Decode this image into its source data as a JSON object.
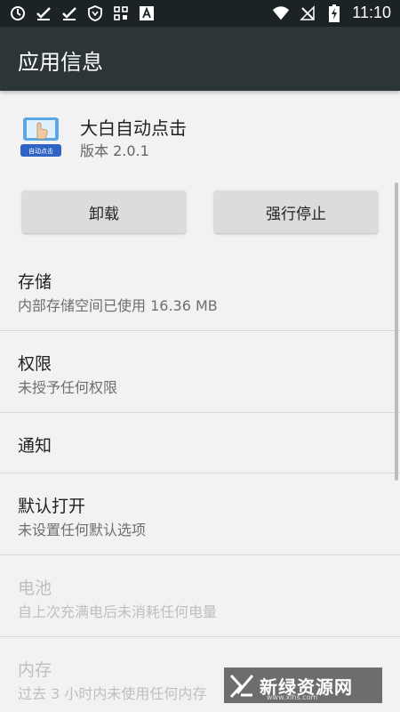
{
  "status_bar": {
    "time": "11:10",
    "left_icons": [
      "sync-icon",
      "check-icon",
      "check-icon",
      "shield-icon",
      "grid-icon",
      "a-box-icon"
    ],
    "right_icons": [
      "wifi-icon",
      "no-signal-icon",
      "battery-charging-icon"
    ]
  },
  "app_bar": {
    "title": "应用信息"
  },
  "app": {
    "name": "大白自动点击",
    "version": "版本 2.0.1",
    "icon_caption": "自动点击"
  },
  "buttons": {
    "uninstall": "卸载",
    "force_stop": "强行停止"
  },
  "sections": [
    {
      "title": "存储",
      "subtitle": "内部存储空间已使用 16.36 MB",
      "enabled": true
    },
    {
      "title": "权限",
      "subtitle": "未授予任何权限",
      "enabled": true
    },
    {
      "title": "通知",
      "subtitle": "",
      "enabled": true
    },
    {
      "title": "默认打开",
      "subtitle": "未设置任何默认选项",
      "enabled": true
    },
    {
      "title": "电池",
      "subtitle": "自上次充满电后未消耗任何电量",
      "enabled": false
    },
    {
      "title": "内存",
      "subtitle": "过去 3 小时内未使用任何内存",
      "enabled": false
    }
  ],
  "watermark": {
    "text": "新绿资源网",
    "url": "www.xlhs.com"
  },
  "colors": {
    "status_bar": "#1c2326",
    "app_bar": "#2c3538",
    "background": "#f2f2f2",
    "button": "#dcdcdc"
  }
}
